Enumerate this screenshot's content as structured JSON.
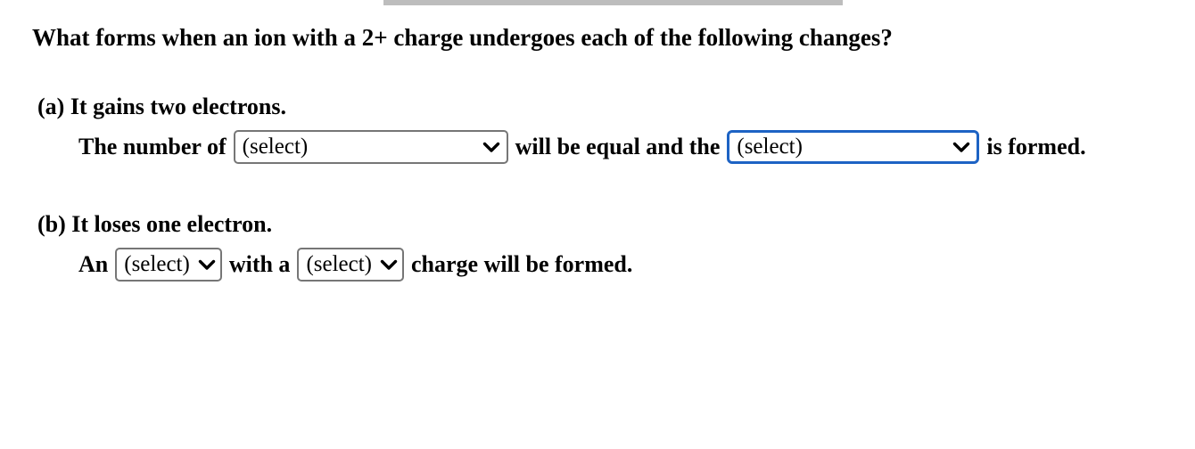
{
  "document": {
    "question": "What forms when an ion with a 2+ charge undergoes each of the following changes?",
    "select_placeholder": "(select)",
    "focus_border_color": "#1d63c4",
    "border_color": "#767676",
    "top_strip_color": "#bdbdbd"
  },
  "parts": {
    "a": {
      "label": "(a) It gains two electrons.",
      "segments": {
        "lead": "The number of",
        "middle": "will be equal and the",
        "tail": "is formed."
      },
      "selects": [
        {
          "name": "part-a-select-1",
          "value": "(select)",
          "focused": false
        },
        {
          "name": "part-a-select-2",
          "value": "(select)",
          "focused": true
        }
      ]
    },
    "b": {
      "label": "(b) It loses one electron.",
      "segments": {
        "lead": "An",
        "middle": "with a",
        "tail": "charge will be formed."
      },
      "selects": [
        {
          "name": "part-b-select-1",
          "value": "(select)",
          "focused": false
        },
        {
          "name": "part-b-select-2",
          "value": "(select)",
          "focused": false
        }
      ]
    }
  }
}
